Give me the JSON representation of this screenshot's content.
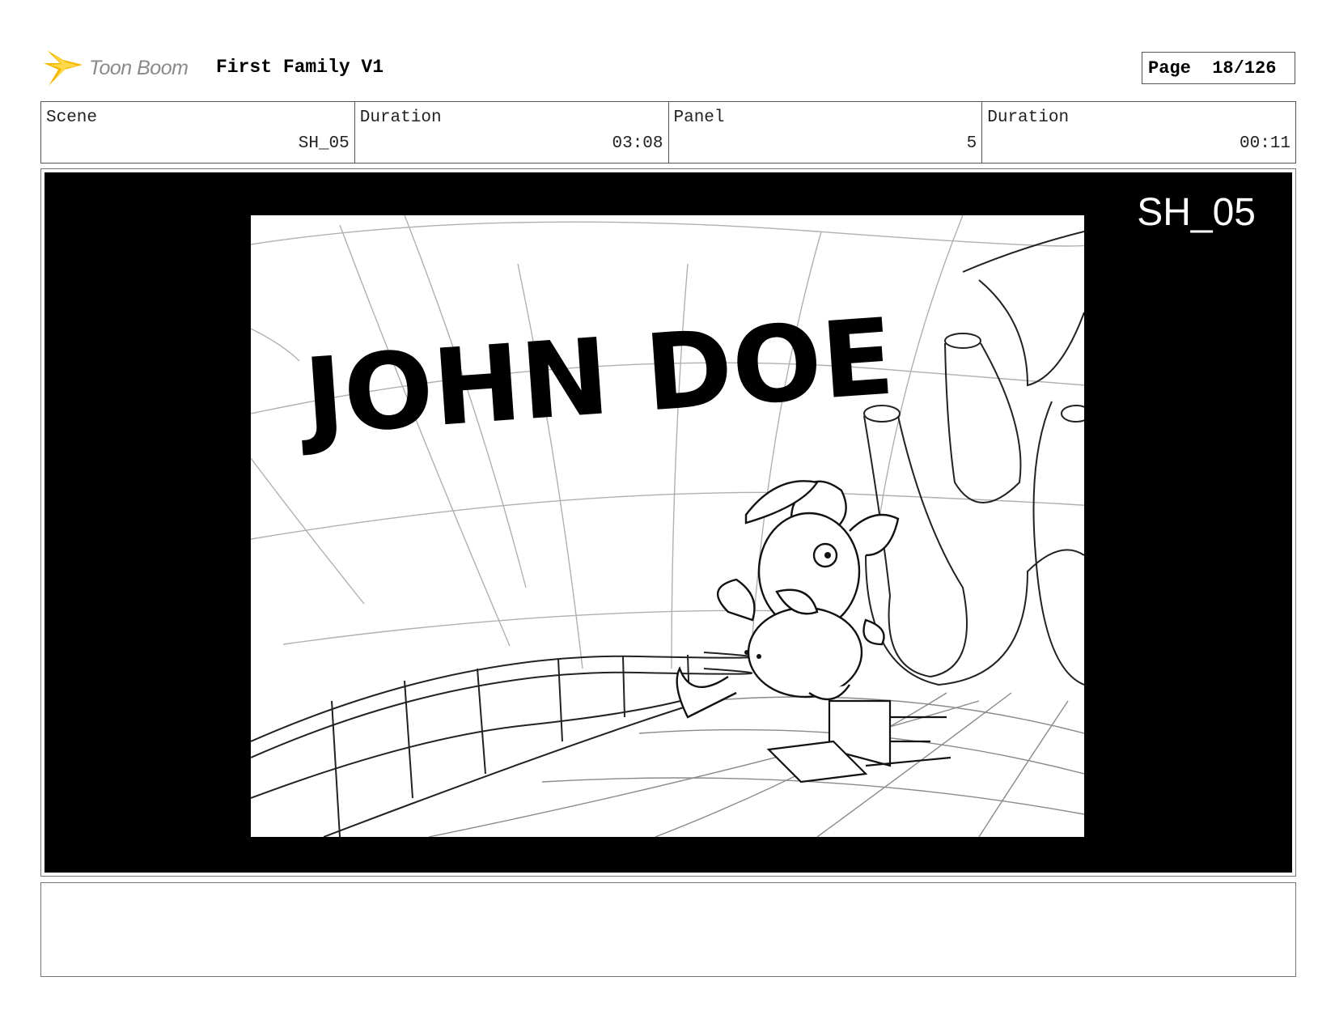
{
  "header": {
    "logo_icon": "toon-boom-star-icon",
    "logo_text": "Toon Boom",
    "project_title": "First Family V1",
    "page_label": "Page",
    "page_value": "18/126"
  },
  "info": [
    {
      "label": "Scene",
      "value": "SH_05"
    },
    {
      "label": "Duration",
      "value": "03:08"
    },
    {
      "label": "Panel",
      "value": "5"
    },
    {
      "label": "Duration",
      "value": "00:11"
    }
  ],
  "panel": {
    "scene_tag": "SH_05",
    "title_card_text": "JOHN DOE",
    "background_color": "#000000"
  },
  "notes": {
    "text": ""
  },
  "colors": {
    "logo_star": "#f5b800",
    "logo_text": "#8a8a8a",
    "border": "#555555"
  }
}
